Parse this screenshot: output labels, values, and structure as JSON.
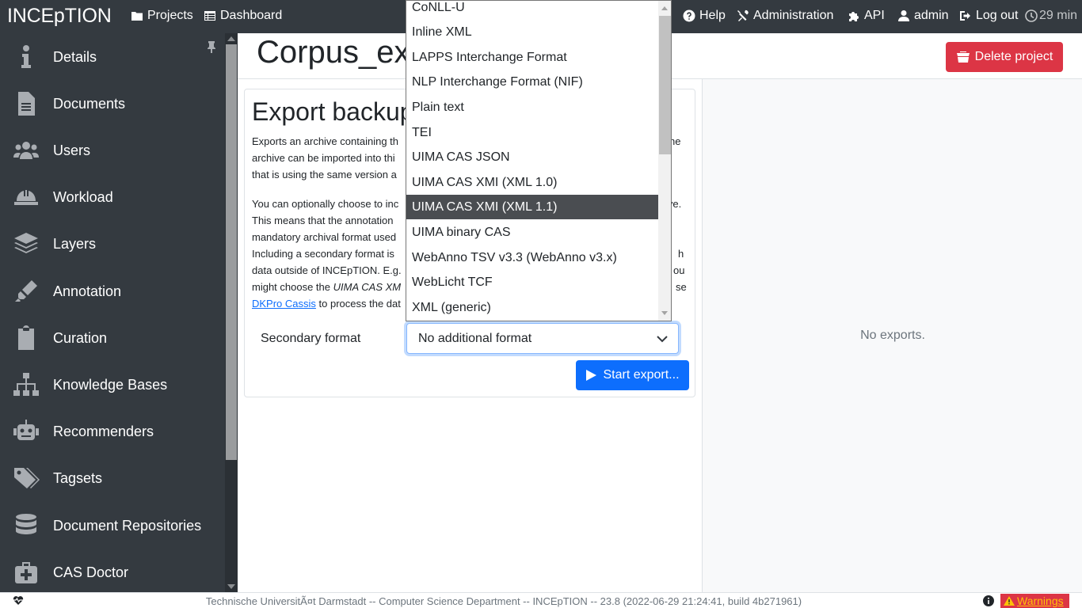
{
  "topbar": {
    "brand": "INCEpTION",
    "projects": "Projects",
    "dashboard": "Dashboard",
    "help": "Help",
    "administration": "Administration",
    "api": "API",
    "user": "admin",
    "logout": "Log out",
    "timer": "29 min"
  },
  "sidebar": {
    "items": [
      {
        "label": "Details",
        "icon": "info-icon"
      },
      {
        "label": "Documents",
        "icon": "file-icon"
      },
      {
        "label": "Users",
        "icon": "users-icon"
      },
      {
        "label": "Workload",
        "icon": "hard-hat-icon"
      },
      {
        "label": "Layers",
        "icon": "layers-icon"
      },
      {
        "label": "Annotation",
        "icon": "highlighter-icon"
      },
      {
        "label": "Curation",
        "icon": "clipboard-icon"
      },
      {
        "label": "Knowledge Bases",
        "icon": "sitemap-icon"
      },
      {
        "label": "Recommenders",
        "icon": "robot-icon"
      },
      {
        "label": "Tagsets",
        "icon": "tags-icon"
      },
      {
        "label": "Document Repositories",
        "icon": "database-icon"
      },
      {
        "label": "CAS Doctor",
        "icon": "medkit-icon"
      }
    ]
  },
  "main": {
    "page_title": "Corpus_exe",
    "delete_label": "Delete project",
    "no_exports": "No exports."
  },
  "export": {
    "title": "Export backup",
    "para1_line1": "Exports an archive containing th",
    "para1_line1_end": "he",
    "para1_line2": "archive can be imported into thi",
    "para1_line3": "that is using the same version a",
    "para2_line1": "You can optionally choose to inc",
    "para2_line1_end": "ive.",
    "para2_line2": "This means that the annotation",
    "para2_line3": "mandatory archival format used",
    "para2_line4": "Including a secondary format is",
    "para2_line4_end": "h",
    "para2_line5": "data outside of INCEpTION. E.g.",
    "para2_line5_end": "ou",
    "para2_line6_pre": "might choose the ",
    "para2_line6_em": "UIMA CAS XM",
    "para2_line6_end": "se",
    "para2_link": "DKPro Cassis",
    "para2_line7_rest": " to process the dat",
    "secondary_label": "Secondary format",
    "select_value": "No additional format",
    "start_label": "Start export..."
  },
  "dropdown": {
    "options": [
      "CoNLL-U",
      "Inline XML",
      "LAPPS Interchange Format",
      "NLP Interchange Format (NIF)",
      "Plain text",
      "TEI",
      "UIMA CAS JSON",
      "UIMA CAS XMI (XML 1.0)",
      "UIMA CAS XMI (XML 1.1)",
      "UIMA binary CAS",
      "WebAnno TSV v3.3 (WebAnno v3.x)",
      "WebLicht TCF",
      "XML (generic)"
    ],
    "highlighted": "UIMA CAS XMI (XML 1.1)"
  },
  "footer": {
    "text": "Technische UniversitÃ¤t Darmstadt -- Computer Science Department -- INCEpTION -- 23.8 (2022-06-29 21:24:41, build 4b271961)",
    "warnings": "Warnings"
  },
  "colors": {
    "navbar": "#343a40",
    "primary": "#0d6efd",
    "danger": "#dc3545",
    "warning": "#ffc107"
  }
}
